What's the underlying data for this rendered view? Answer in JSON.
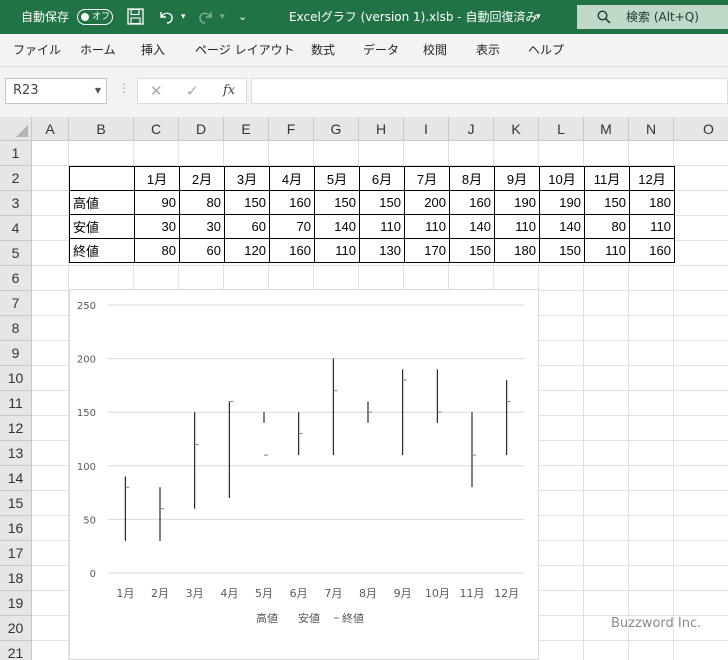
{
  "titlebar": {
    "autosave_label": "自動保存",
    "autosave_state": "オフ",
    "file_title": "Excelグラフ (version 1).xlsb  -  自動回復済み",
    "search_label": "検索 (Alt+Q)",
    "accent": "#217346"
  },
  "menu": [
    "ファイル",
    "ホーム",
    "挿入",
    "ページ レイアウト",
    "数式",
    "データ",
    "校閲",
    "表示",
    "ヘルプ"
  ],
  "formula_bar": {
    "name_box": "R23",
    "fx_label": "fx",
    "formula": ""
  },
  "columns": [
    "A",
    "B",
    "C",
    "D",
    "E",
    "F",
    "G",
    "H",
    "I",
    "J",
    "K",
    "L",
    "M",
    "N",
    "O"
  ],
  "rows": [
    "1",
    "2",
    "3",
    "4",
    "5",
    "6",
    "7",
    "8",
    "9",
    "10",
    "11",
    "12",
    "13",
    "14",
    "15",
    "16",
    "17",
    "18",
    "19",
    "20",
    "21"
  ],
  "table": {
    "months": [
      "1月",
      "2月",
      "3月",
      "4月",
      "5月",
      "6月",
      "7月",
      "8月",
      "9月",
      "10月",
      "11月",
      "12月"
    ],
    "rows": [
      {
        "label": "高値",
        "values": [
          90,
          80,
          150,
          160,
          150,
          150,
          200,
          160,
          190,
          190,
          150,
          180
        ]
      },
      {
        "label": "安値",
        "values": [
          30,
          30,
          60,
          70,
          140,
          110,
          110,
          140,
          110,
          140,
          80,
          110
        ]
      },
      {
        "label": "終値",
        "values": [
          80,
          60,
          120,
          160,
          110,
          130,
          170,
          150,
          180,
          150,
          110,
          160
        ]
      }
    ]
  },
  "chart_data": {
    "type": "high-low-close (stock)",
    "categories": [
      "1月",
      "2月",
      "3月",
      "4月",
      "5月",
      "6月",
      "7月",
      "8月",
      "9月",
      "10月",
      "11月",
      "12月"
    ],
    "series": [
      {
        "name": "高値",
        "values": [
          90,
          80,
          150,
          160,
          150,
          150,
          200,
          160,
          190,
          190,
          150,
          180
        ]
      },
      {
        "name": "安値",
        "values": [
          30,
          30,
          60,
          70,
          140,
          110,
          110,
          140,
          110,
          140,
          80,
          110
        ]
      },
      {
        "name": "終値",
        "values": [
          80,
          60,
          120,
          160,
          110,
          130,
          170,
          150,
          180,
          150,
          110,
          160
        ]
      }
    ],
    "yticks": [
      "0",
      "50",
      "100",
      "150",
      "200",
      "250"
    ],
    "ylim": [
      0,
      250
    ],
    "grid": true,
    "legend_position": "bottom",
    "legend": [
      "高値",
      "安値",
      "終値"
    ],
    "line_color": "#000000"
  },
  "watermark": "Buzzword Inc."
}
